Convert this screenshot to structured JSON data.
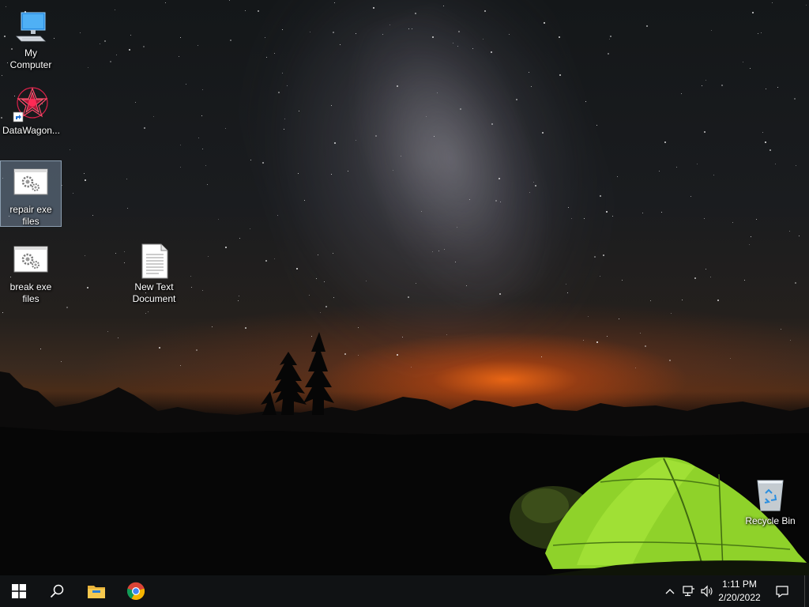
{
  "desktop": {
    "icons": [
      {
        "id": "my-computer",
        "label": "My Computer"
      },
      {
        "id": "datawagon",
        "label": "DataWagon..."
      },
      {
        "id": "repair-exe",
        "label": "repair exe files"
      },
      {
        "id": "break-exe",
        "label": "break exe files"
      },
      {
        "id": "new-text-document",
        "label": "New Text Document"
      },
      {
        "id": "recycle-bin",
        "label": "Recycle Bin"
      }
    ]
  },
  "taskbar": {
    "start_icon": "windows-logo-icon",
    "search_icon": "search-icon",
    "pinned": [
      {
        "name": "file-explorer-icon"
      },
      {
        "name": "chrome-icon"
      }
    ],
    "tray": {
      "icons": [
        "chevron-up-icon",
        "network-icon",
        "volume-icon"
      ],
      "time": "1:11 PM",
      "date": "2/20/2022",
      "notification_icon": "notification-icon"
    }
  },
  "colors": {
    "taskbar": "#101214",
    "tent": "#8fd22a",
    "sunset_glow": "#e8621a",
    "selection": "#a0bedc"
  }
}
